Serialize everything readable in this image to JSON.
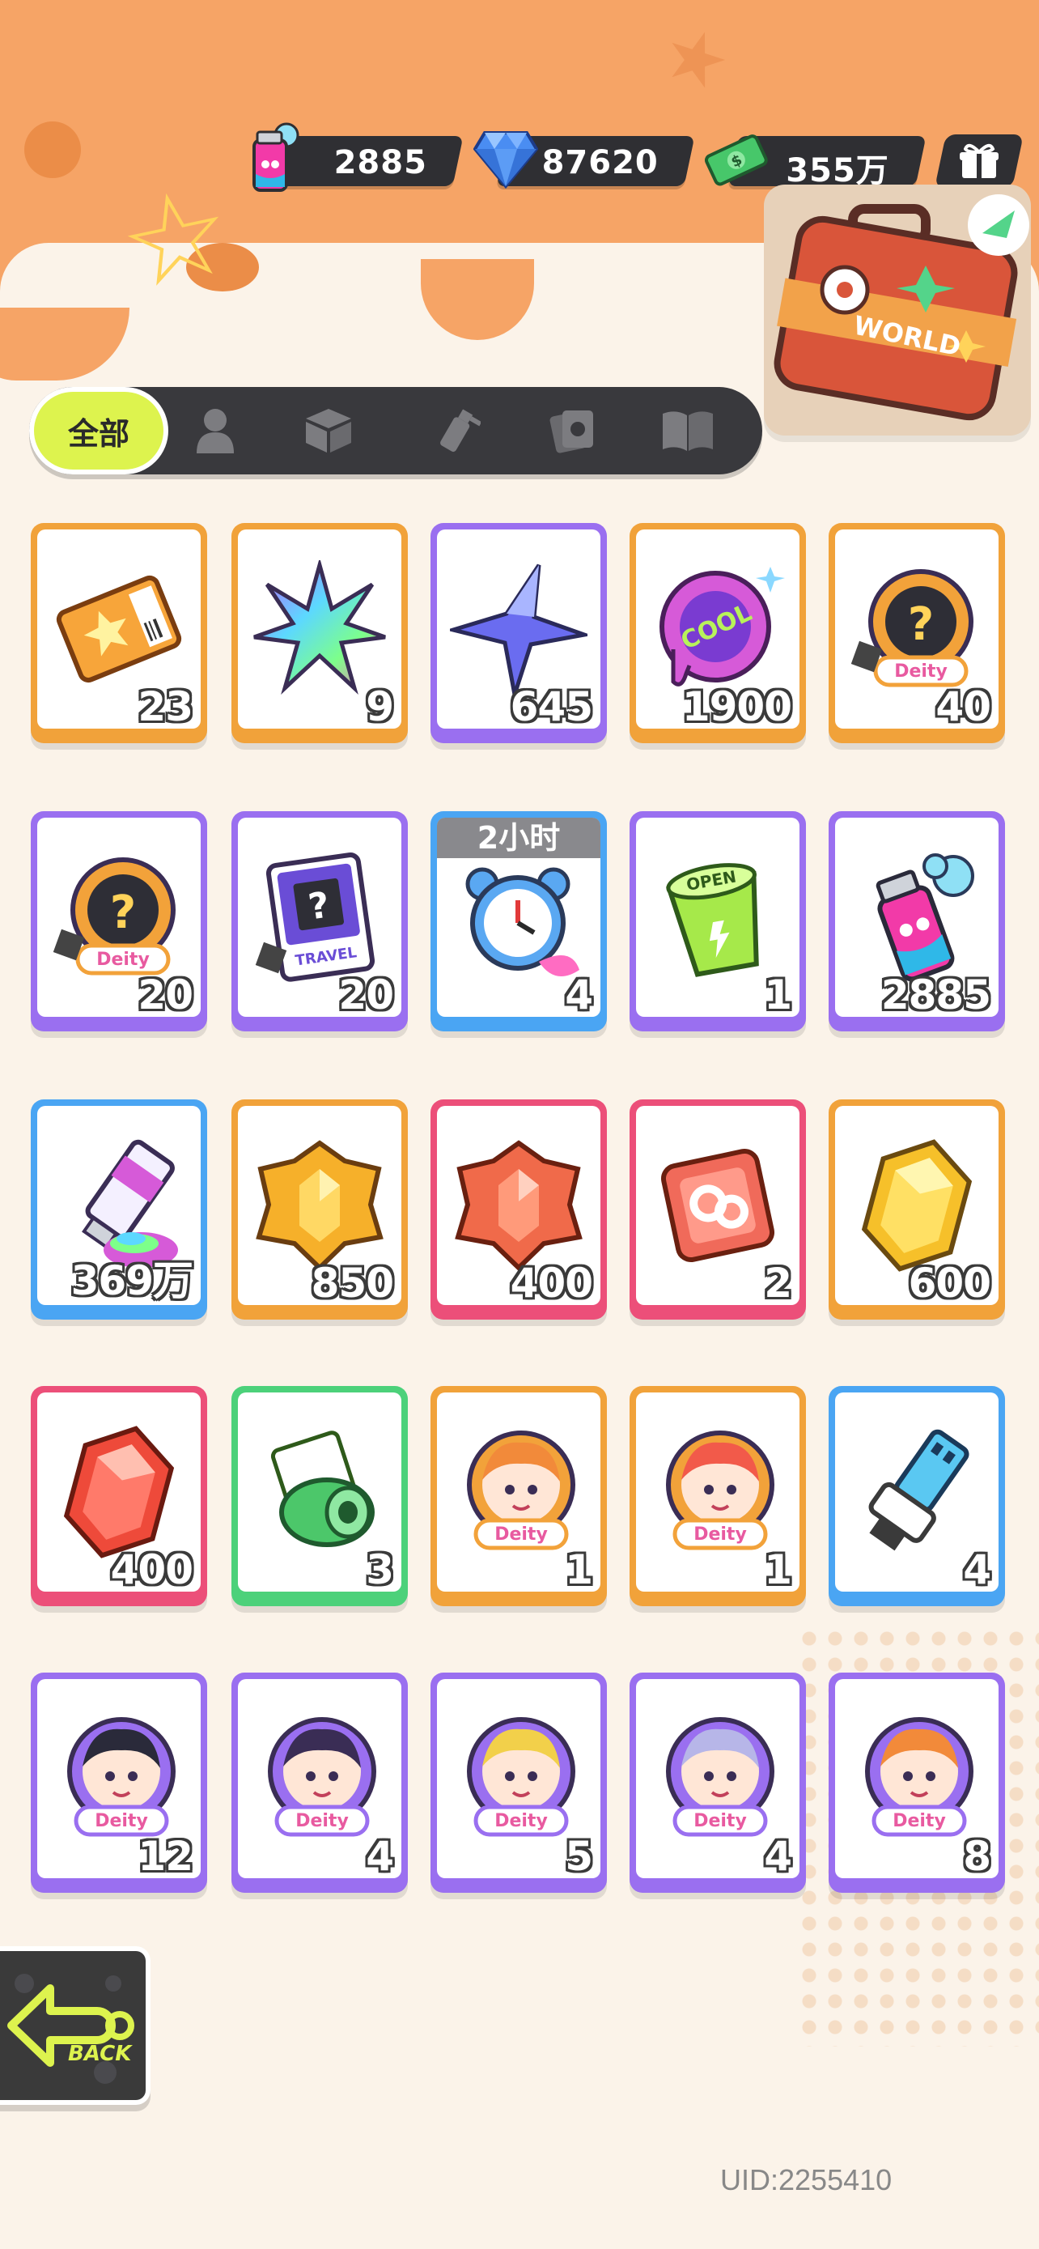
{
  "currency": {
    "spray": "2885",
    "diamond": "87620",
    "cash": "355万"
  },
  "world": {
    "label": "WORLD"
  },
  "tabs": {
    "active_label": "全部"
  },
  "items": [
    {
      "count": "23",
      "frame": "orange",
      "icon": "ticket-icon"
    },
    {
      "count": "9",
      "frame": "orange",
      "icon": "rainbow-star-icon"
    },
    {
      "count": "645",
      "frame": "purple",
      "icon": "blue-star-icon"
    },
    {
      "count": "1900",
      "frame": "orange",
      "icon": "cool-badge-icon"
    },
    {
      "count": "40",
      "frame": "orange",
      "icon": "deity-mystery-icon"
    },
    {
      "count": "20",
      "frame": "purple",
      "icon": "deity-mystery-icon"
    },
    {
      "count": "20",
      "frame": "purple",
      "icon": "travel-card-icon"
    },
    {
      "count": "4",
      "frame": "blue",
      "icon": "alarm-clock-icon",
      "timer": "2小时"
    },
    {
      "count": "1",
      "frame": "purple",
      "icon": "green-cup-icon"
    },
    {
      "count": "2885",
      "frame": "purple",
      "icon": "spray-can-icon"
    },
    {
      "count": "369万",
      "frame": "blue",
      "icon": "paint-tube-icon"
    },
    {
      "count": "850",
      "frame": "orange",
      "icon": "yellow-crystal-icon"
    },
    {
      "count": "400",
      "frame": "pink",
      "icon": "red-crystal-icon"
    },
    {
      "count": "2",
      "frame": "pink",
      "icon": "go-cube-icon"
    },
    {
      "count": "600",
      "frame": "orange",
      "icon": "yellow-gem-icon"
    },
    {
      "count": "400",
      "frame": "pink",
      "icon": "red-gem-icon"
    },
    {
      "count": "3",
      "frame": "green",
      "icon": "cash-roll-icon"
    },
    {
      "count": "1",
      "frame": "orange",
      "icon": "deity-portrait-icon"
    },
    {
      "count": "1",
      "frame": "orange",
      "icon": "deity-portrait-icon"
    },
    {
      "count": "4",
      "frame": "blue",
      "icon": "usb-key-icon"
    },
    {
      "count": "12",
      "frame": "purple",
      "icon": "deity-portrait-icon"
    },
    {
      "count": "4",
      "frame": "purple",
      "icon": "deity-portrait-icon"
    },
    {
      "count": "5",
      "frame": "purple",
      "icon": "deity-portrait-icon"
    },
    {
      "count": "4",
      "frame": "purple",
      "icon": "deity-portrait-icon"
    },
    {
      "count": "8",
      "frame": "purple",
      "icon": "deity-portrait-icon"
    }
  ],
  "back": {
    "label": "BACK"
  },
  "uid": "UID:2255410"
}
